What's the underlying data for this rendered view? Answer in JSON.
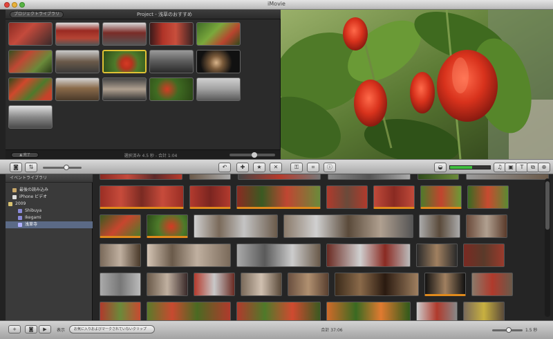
{
  "window": {
    "title": "iMovie"
  },
  "project_pane": {
    "library_button": "プロジェクトライブラリ",
    "project_title": "Project - 浅草のおすすめ",
    "footer_button": "▲ 完了",
    "footer_status": "選択済み 4.5 秒 - 合計 1:04",
    "zoom_value": 0.55
  },
  "event_library": {
    "header": "イベントライブラリ",
    "items": [
      {
        "label": "最後の読み込み",
        "icon": "film-icon"
      },
      {
        "label": "iPhone ビデオ",
        "icon": "iphone-icon"
      },
      {
        "label": "2009",
        "icon": "folder-icon"
      },
      {
        "label": "Shibuya",
        "icon": "star-icon"
      },
      {
        "label": "Ikegami",
        "icon": "star-icon"
      },
      {
        "label": "浅草寺",
        "icon": "star-icon",
        "selected": true
      }
    ]
  },
  "toolbar": {
    "icons": [
      "camera-icon",
      "undo-icon",
      "add-clip-icon",
      "favorite-icon",
      "reject-icon",
      "keyword-icon",
      "crop-icon",
      "info-icon"
    ],
    "audio_level": 0.55,
    "right_icons": [
      "music-icon",
      "photo-icon",
      "title-icon",
      "transition-icon",
      "map-icon"
    ]
  },
  "bottombar": {
    "show_label": "表示",
    "select_value": "お気に入りおよびマークされていないクリップ",
    "status": "合計 37:06",
    "zoom_label": "1.5 秒",
    "slider_value": 0.55
  },
  "colors": {
    "selection_yellow": "#e0c234",
    "favorite_orange": "#e08a1c",
    "sidebar_selected": "#5b6a86"
  }
}
